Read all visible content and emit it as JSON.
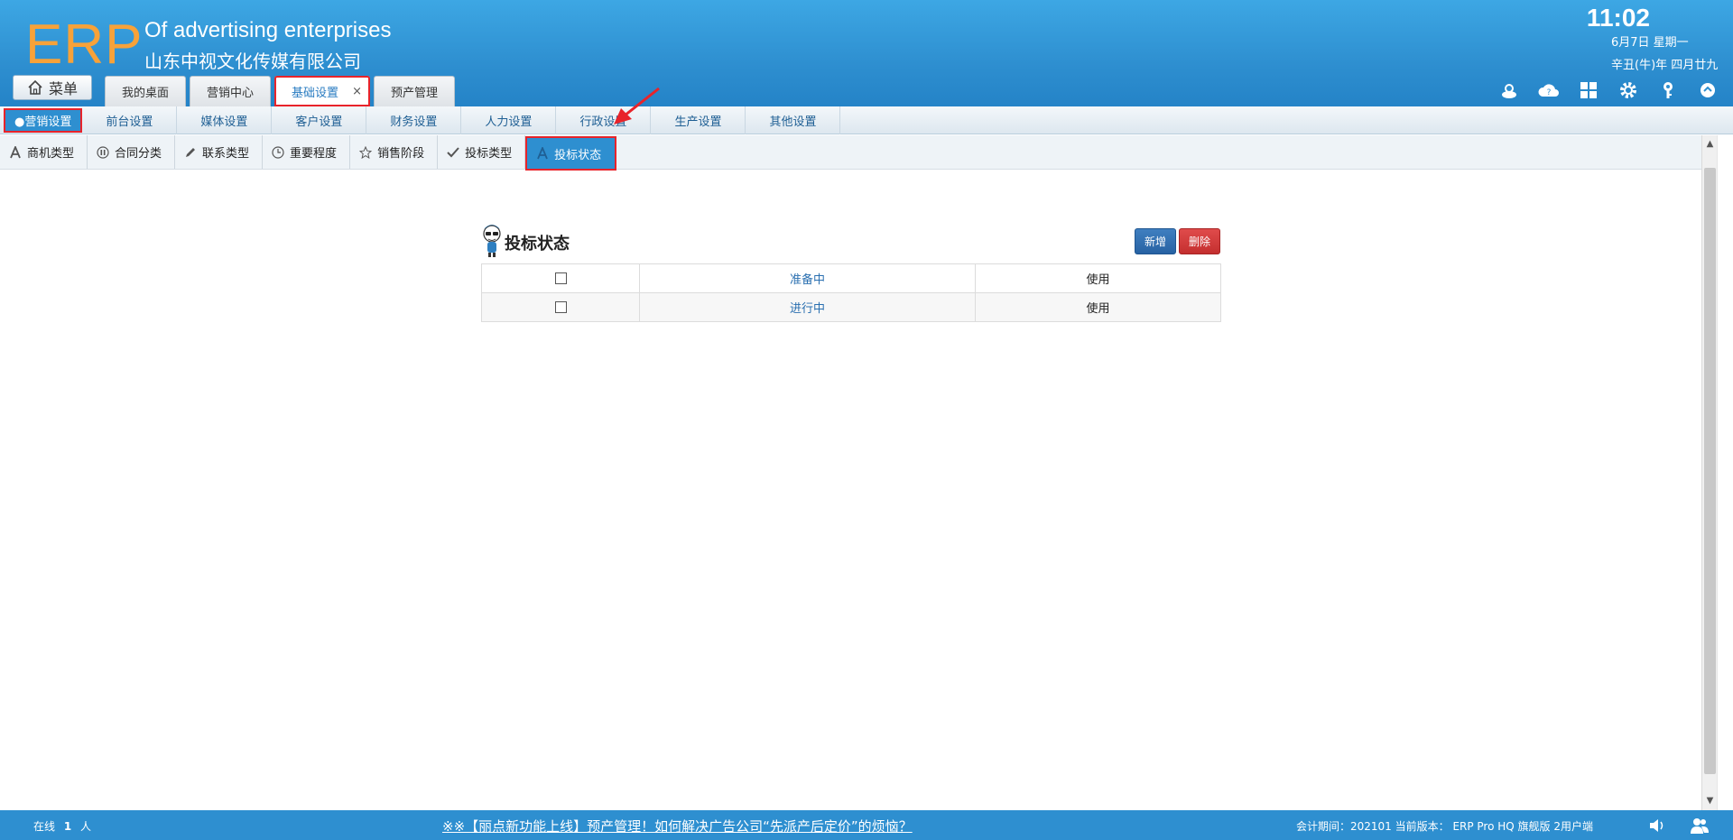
{
  "header": {
    "logo": "ERP",
    "company_en": "Of advertising enterprises",
    "company_cn": "山东中视文化传媒有限公司",
    "time": "11:02",
    "date": "6月7日 星期一",
    "lunar": "辛丑(牛)年 四月廿九",
    "menu_label": "菜单"
  },
  "tabs": [
    {
      "label": "我的桌面"
    },
    {
      "label": "营销中心"
    },
    {
      "label": "基础设置",
      "close": "×"
    },
    {
      "label": "预产管理"
    }
  ],
  "subnav": [
    {
      "label": "●营销设置"
    },
    {
      "label": "前台设置"
    },
    {
      "label": "媒体设置"
    },
    {
      "label": "客户设置"
    },
    {
      "label": "财务设置"
    },
    {
      "label": "人力设置"
    },
    {
      "label": "行政设置"
    },
    {
      "label": "生产设置"
    },
    {
      "label": "其他设置"
    }
  ],
  "thirdnav": [
    {
      "label": "商机类型",
      "icon": "letter-a-icon"
    },
    {
      "label": "合同分类",
      "icon": "pause-circle-icon"
    },
    {
      "label": "联系类型",
      "icon": "pencil-icon"
    },
    {
      "label": "重要程度",
      "icon": "clock-icon"
    },
    {
      "label": "销售阶段",
      "icon": "star-icon"
    },
    {
      "label": "投标类型",
      "icon": "check-icon"
    },
    {
      "label": "投标状态",
      "icon": "letter-a-icon"
    }
  ],
  "panel": {
    "title": "投标状态",
    "add_label": "新增",
    "delete_label": "删除",
    "rows": [
      {
        "name": "准备中",
        "status": "使用"
      },
      {
        "name": "进行中",
        "status": "使用"
      }
    ]
  },
  "footer": {
    "online_prefix": "在线",
    "online_count": "1",
    "online_suffix": "人",
    "notice": "※※【丽点新功能上线】预产管理！如何解决广告公司“先派产后定价”的烦恼？",
    "version": "会计期间：202101 当前版本： ERP Pro HQ 旗舰版 2用户端"
  },
  "colors": {
    "header_blue": "#2e8fd0",
    "logo_orange": "#f7a239",
    "highlight_red": "#e8232a",
    "add_button": "#2762a3",
    "delete_button": "#c42f2f"
  }
}
